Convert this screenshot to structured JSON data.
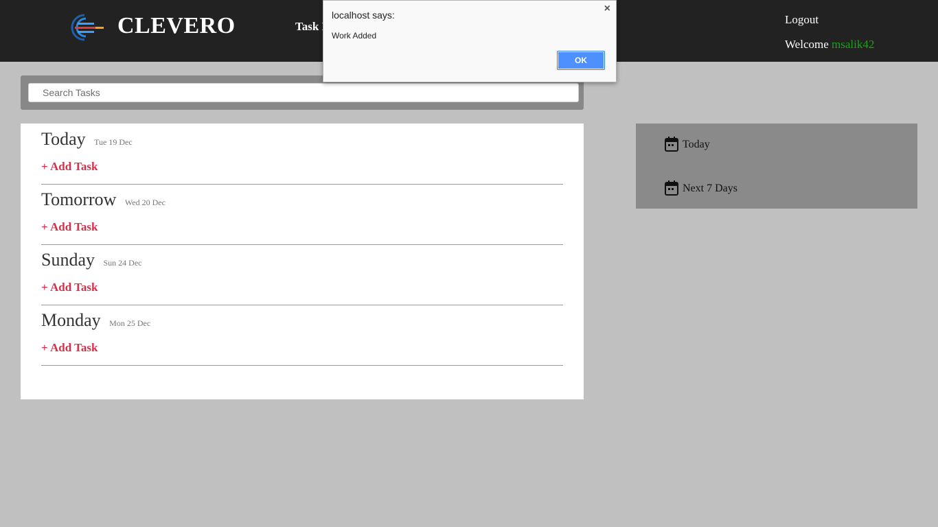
{
  "header": {
    "brand": "CLEVERO",
    "nav_title": "Task M",
    "logout": "Logout",
    "welcome_label": "Welcome",
    "username": "msalik42"
  },
  "search": {
    "placeholder": "Search Tasks"
  },
  "days": [
    {
      "name": "Today",
      "date": "Tue 19 Dec",
      "add_label": "+ Add Task"
    },
    {
      "name": "Tomorrow",
      "date": "Wed 20 Dec",
      "add_label": "+ Add Task"
    },
    {
      "name": "Sunday",
      "date": "Sun 24 Dec",
      "add_label": "+ Add Task"
    },
    {
      "name": "Monday",
      "date": "Mon 25 Dec",
      "add_label": "+ Add Task"
    }
  ],
  "sidebar": {
    "items": [
      {
        "label": "Today",
        "icon": "calendar-icon"
      },
      {
        "label": "Next 7 Days",
        "icon": "calendar-icon"
      }
    ]
  },
  "dialog": {
    "title": "localhost says:",
    "message": "Work Added",
    "ok_label": "OK",
    "close_glyph": "×"
  },
  "colors": {
    "header_bg": "#222222",
    "page_bg": "#c0c0c0",
    "add_task": "#d9304a",
    "username": "#1f9e1f",
    "ok_button": "#4d90fe"
  }
}
